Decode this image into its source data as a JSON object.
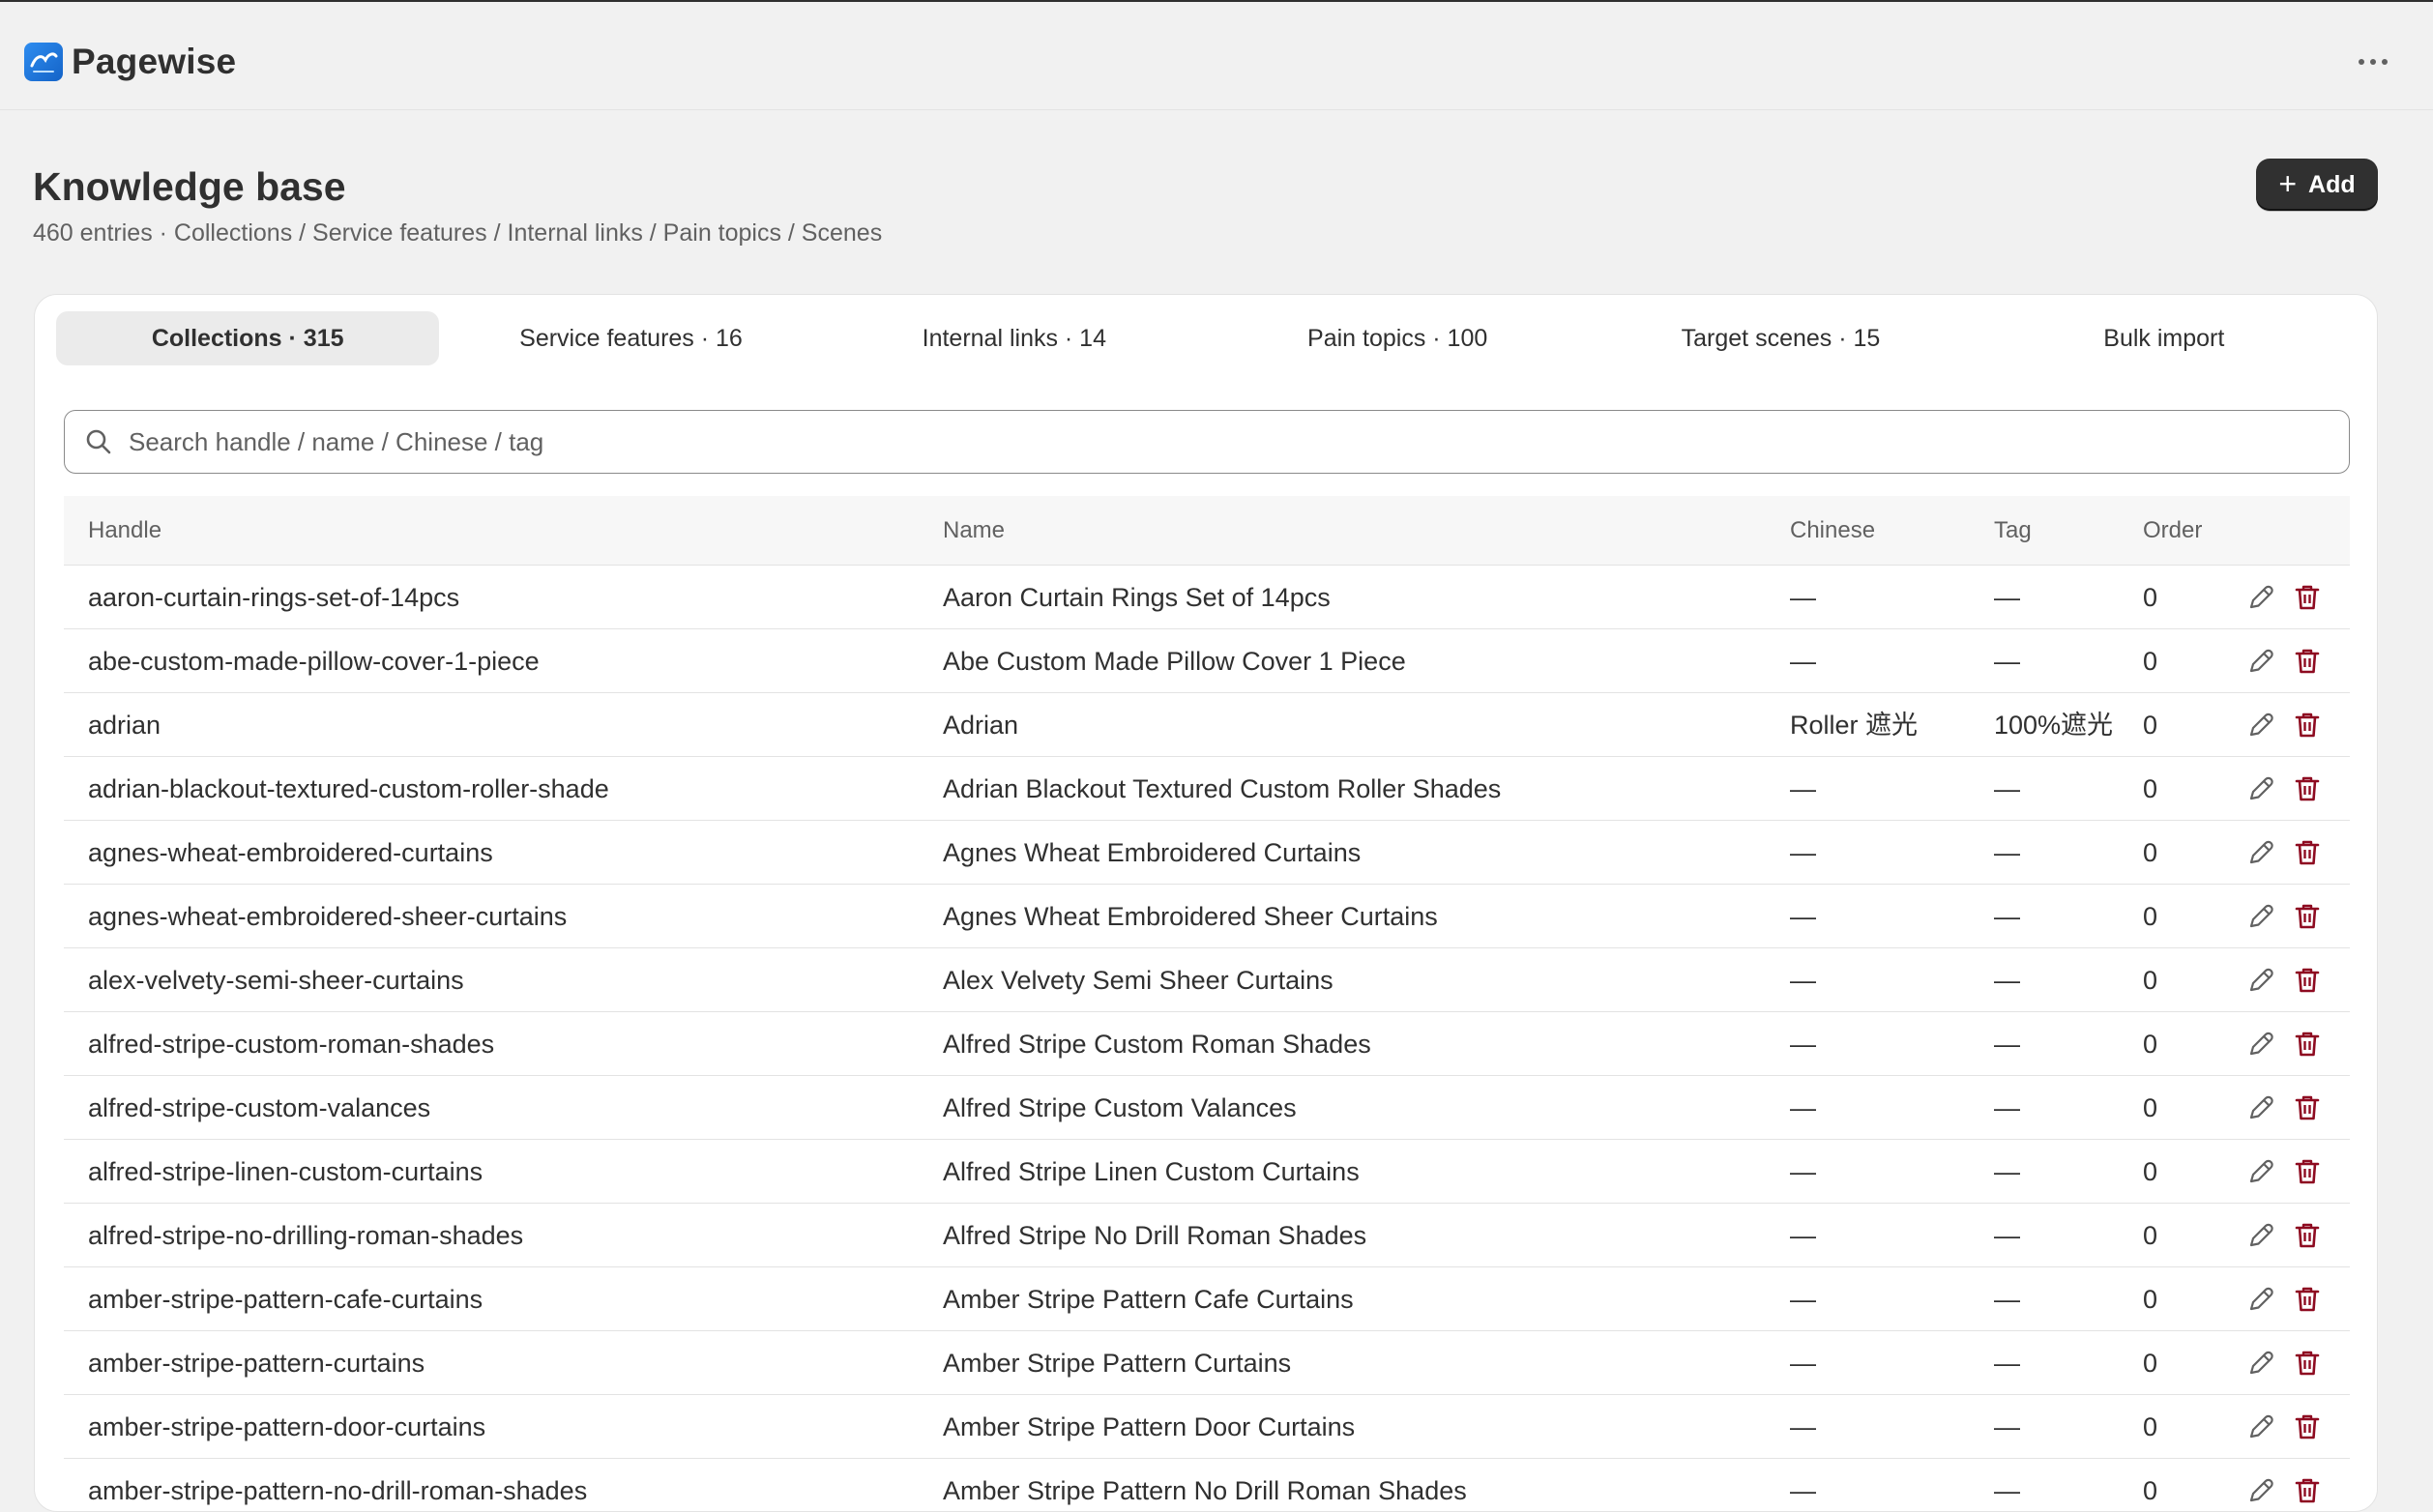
{
  "app": {
    "name": "Pagewise",
    "more_icon": "more-horizontal-icon"
  },
  "header": {
    "title": "Knowledge base",
    "subtitle": "460 entries · Collections / Service features / Internal links / Pain topics / Scenes",
    "add_label": "Add"
  },
  "tabs": [
    {
      "label": "Collections · 315",
      "active": true
    },
    {
      "label": "Service features · 16"
    },
    {
      "label": "Internal links · 14"
    },
    {
      "label": "Pain topics · 100"
    },
    {
      "label": "Target scenes · 15"
    },
    {
      "label": "Bulk import"
    }
  ],
  "search": {
    "placeholder": "Search handle / name / Chinese / tag",
    "value": ""
  },
  "table": {
    "columns": {
      "handle": "Handle",
      "name": "Name",
      "chinese": "Chinese",
      "tag": "Tag",
      "order": "Order"
    },
    "rows": [
      {
        "handle": "aaron-curtain-rings-set-of-14pcs",
        "name": "Aaron Curtain Rings Set of 14pcs",
        "chinese": "—",
        "tag": "—",
        "order": "0"
      },
      {
        "handle": "abe-custom-made-pillow-cover-1-piece",
        "name": "Abe Custom Made Pillow Cover 1 Piece",
        "chinese": "—",
        "tag": "—",
        "order": "0"
      },
      {
        "handle": "adrian",
        "name": "Adrian",
        "chinese": "Roller 遮光",
        "tag": "100%遮光",
        "order": "0"
      },
      {
        "handle": "adrian-blackout-textured-custom-roller-shade",
        "name": "Adrian Blackout Textured Custom Roller Shades",
        "chinese": "—",
        "tag": "—",
        "order": "0"
      },
      {
        "handle": "agnes-wheat-embroidered-curtains",
        "name": "Agnes Wheat Embroidered Curtains",
        "chinese": "—",
        "tag": "—",
        "order": "0"
      },
      {
        "handle": "agnes-wheat-embroidered-sheer-curtains",
        "name": "Agnes Wheat Embroidered Sheer Curtains",
        "chinese": "—",
        "tag": "—",
        "order": "0"
      },
      {
        "handle": "alex-velvety-semi-sheer-curtains",
        "name": "Alex Velvety Semi Sheer Curtains",
        "chinese": "—",
        "tag": "—",
        "order": "0"
      },
      {
        "handle": "alfred-stripe-custom-roman-shades",
        "name": "Alfred Stripe Custom Roman Shades",
        "chinese": "—",
        "tag": "—",
        "order": "0"
      },
      {
        "handle": "alfred-stripe-custom-valances",
        "name": "Alfred Stripe Custom Valances",
        "chinese": "—",
        "tag": "—",
        "order": "0"
      },
      {
        "handle": "alfred-stripe-linen-custom-curtains",
        "name": "Alfred Stripe Linen Custom Curtains",
        "chinese": "—",
        "tag": "—",
        "order": "0"
      },
      {
        "handle": "alfred-stripe-no-drilling-roman-shades",
        "name": "Alfred Stripe No Drill Roman Shades",
        "chinese": "—",
        "tag": "—",
        "order": "0"
      },
      {
        "handle": "amber-stripe-pattern-cafe-curtains",
        "name": "Amber Stripe Pattern Cafe Curtains",
        "chinese": "—",
        "tag": "—",
        "order": "0"
      },
      {
        "handle": "amber-stripe-pattern-curtains",
        "name": "Amber Stripe Pattern Curtains",
        "chinese": "—",
        "tag": "—",
        "order": "0"
      },
      {
        "handle": "amber-stripe-pattern-door-curtains",
        "name": "Amber Stripe Pattern Door Curtains",
        "chinese": "—",
        "tag": "—",
        "order": "0"
      },
      {
        "handle": "amber-stripe-pattern-no-drill-roman-shades",
        "name": "Amber Stripe Pattern No Drill Roman Shades",
        "chinese": "—",
        "tag": "—",
        "order": "0"
      }
    ],
    "row_actions": {
      "edit_icon": "pencil-icon",
      "delete_icon": "trash-icon"
    }
  },
  "colors": {
    "primary_button": "#303030",
    "delete": "#8e0b21",
    "background": "#f1f1f1",
    "card": "#ffffff"
  }
}
